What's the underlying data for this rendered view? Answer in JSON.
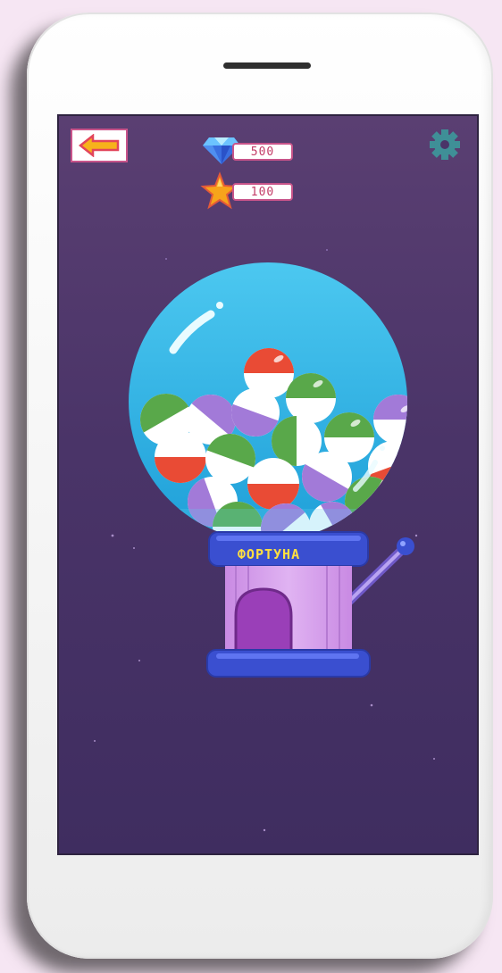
{
  "header": {
    "gems_value": "500",
    "stars_value": "100"
  },
  "machine": {
    "label": "ФОРТУНА"
  },
  "icons": {
    "back": "arrow-left-icon",
    "settings": "gear-icon",
    "gem": "diamond-icon",
    "star": "star-icon"
  },
  "colors": {
    "background": "#4a3468",
    "globe": "#3fc0e6",
    "accent_pink": "#c8548a",
    "machine_blue": "#3a4fd0",
    "machine_body": "#d7a0ec",
    "label_yellow": "#ffe040"
  }
}
